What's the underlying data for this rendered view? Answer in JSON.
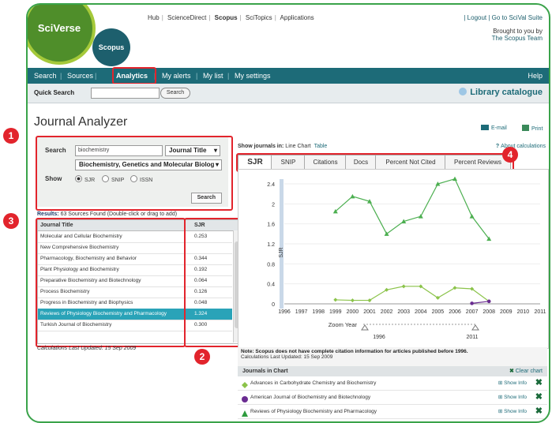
{
  "brand": {
    "sciverse": "SciVerse",
    "scopus": "Scopus"
  },
  "top_links": [
    "Hub",
    "ScienceDirect",
    "Scopus",
    "SciTopics",
    "Applications"
  ],
  "top_right": {
    "logout": "| Logout | Go to SciVal Suite",
    "brought1": "Brought to you by",
    "brought2": "The Scopus Team"
  },
  "nav": {
    "items": [
      "Search",
      "Sources",
      "Analytics",
      "My alerts",
      "My list",
      "My settings"
    ],
    "help": "Help"
  },
  "quick": {
    "label": "Quick Search",
    "value": "",
    "button": "Search",
    "library": "Library catalogue"
  },
  "page_title": "Journal Analyzer",
  "search_panel": {
    "search_label": "Search",
    "search_value": "biochemistry",
    "field_select": "Journal Title",
    "subject_select": "Biochemistry, Genetics and Molecular Biolog",
    "show_label": "Show",
    "radios": [
      "SJR",
      "SNIP",
      "ISSN"
    ],
    "selected_radio": "SJR",
    "search_button": "Search"
  },
  "results": {
    "prefix": "Results:",
    "text": "63 Sources Found (Double-click or drag to add)"
  },
  "table": {
    "headers": [
      "Journal Title",
      "SJR"
    ],
    "rows": [
      {
        "title": "Molecular and Cellular Biochemistry",
        "sjr": "0.253"
      },
      {
        "title": "New Comprehensive Biochemistry",
        "sjr": ""
      },
      {
        "title": "Pharmacology, Biochemistry and Behavior",
        "sjr": "0.344"
      },
      {
        "title": "Plant Physiology and Biochemistry",
        "sjr": "0.192"
      },
      {
        "title": "Preparative Biochemistry and Biotechnology",
        "sjr": "0.064"
      },
      {
        "title": "Process Biochemistry",
        "sjr": "0.126"
      },
      {
        "title": "Progress in Biochemistry and Biophysics",
        "sjr": "0.048"
      },
      {
        "title": "Reviews of Physiology Biochemistry and Pharmacology",
        "sjr": "1.324"
      },
      {
        "title": "Turkish Journal of Biochemistry",
        "sjr": "0.300"
      }
    ],
    "selected_index": 7
  },
  "calc_updated": "Calculations Last Updated: 15 Sep 2009",
  "show_journals": {
    "label": "Show journals in:",
    "line": "Line Chart",
    "table": "Table"
  },
  "actions": {
    "email": "E-mail",
    "print": "Print",
    "about": "About calculations"
  },
  "tabs": [
    "SJR",
    "SNIP",
    "Citations",
    "Docs",
    "Percent Not Cited",
    "Percent Reviews"
  ],
  "active_tab": "SJR",
  "zoom": {
    "label": "Zoom Year",
    "from": "1996",
    "to": "2011"
  },
  "note": {
    "bold": "Note: Scopus does not have complete citation information for articles published before 1996.",
    "sub": "Calculations Last Updated: 15 Sep 2009"
  },
  "journals_in_chart": {
    "title": "Journals in Chart",
    "clear": "Clear chart",
    "show_info": "Show Info",
    "items": [
      {
        "name": "Advances in Carbohydrate Chemistry and Biochemistry",
        "color": "#8bc34a",
        "marker": "diamond"
      },
      {
        "name": "American Journal of Biochemistry and Biotechnology",
        "color": "#6a2c91",
        "marker": "circle"
      },
      {
        "name": "Reviews of Physiology Biochemistry and Pharmacology",
        "color": "#2e9b3e",
        "marker": "triangle"
      }
    ]
  },
  "badges": [
    "1",
    "2",
    "3",
    "4"
  ],
  "chart_data": {
    "type": "line",
    "ylabel": "SJR",
    "xlabel": "",
    "x": [
      1996,
      1997,
      1998,
      1999,
      2000,
      2001,
      2002,
      2003,
      2004,
      2005,
      2006,
      2007,
      2008,
      2009,
      2010,
      2011
    ],
    "ylim": [
      0,
      2.4
    ],
    "yticks": [
      0,
      0.4,
      0.8,
      1.2,
      1.6,
      2.0,
      2.4
    ],
    "ytick_labels": [
      "0",
      "0.4",
      "0.8",
      "1.2",
      "1.6",
      "2",
      "2.4"
    ],
    "series": [
      {
        "name": "Reviews of Physiology Biochemistry and Pharmacology",
        "color": "#4caf50",
        "x": [
          1999,
          2000,
          2001,
          2002,
          2003,
          2004,
          2005,
          2006,
          2007,
          2008
        ],
        "values": [
          1.85,
          2.15,
          2.05,
          1.4,
          1.65,
          1.75,
          2.4,
          2.5,
          1.75,
          1.3
        ]
      },
      {
        "name": "Advances in Carbohydrate Chemistry and Biochemistry",
        "color": "#8bc34a",
        "x": [
          1999,
          2000,
          2001,
          2002,
          2003,
          2004,
          2005,
          2006,
          2007,
          2008
        ],
        "values": [
          0.08,
          0.07,
          0.07,
          0.28,
          0.35,
          0.35,
          0.12,
          0.32,
          0.3,
          0.05
        ]
      },
      {
        "name": "American Journal of Biochemistry and Biotechnology",
        "color": "#6a2c91",
        "x": [
          2007,
          2008
        ],
        "values": [
          0.01,
          0.05
        ]
      }
    ]
  }
}
